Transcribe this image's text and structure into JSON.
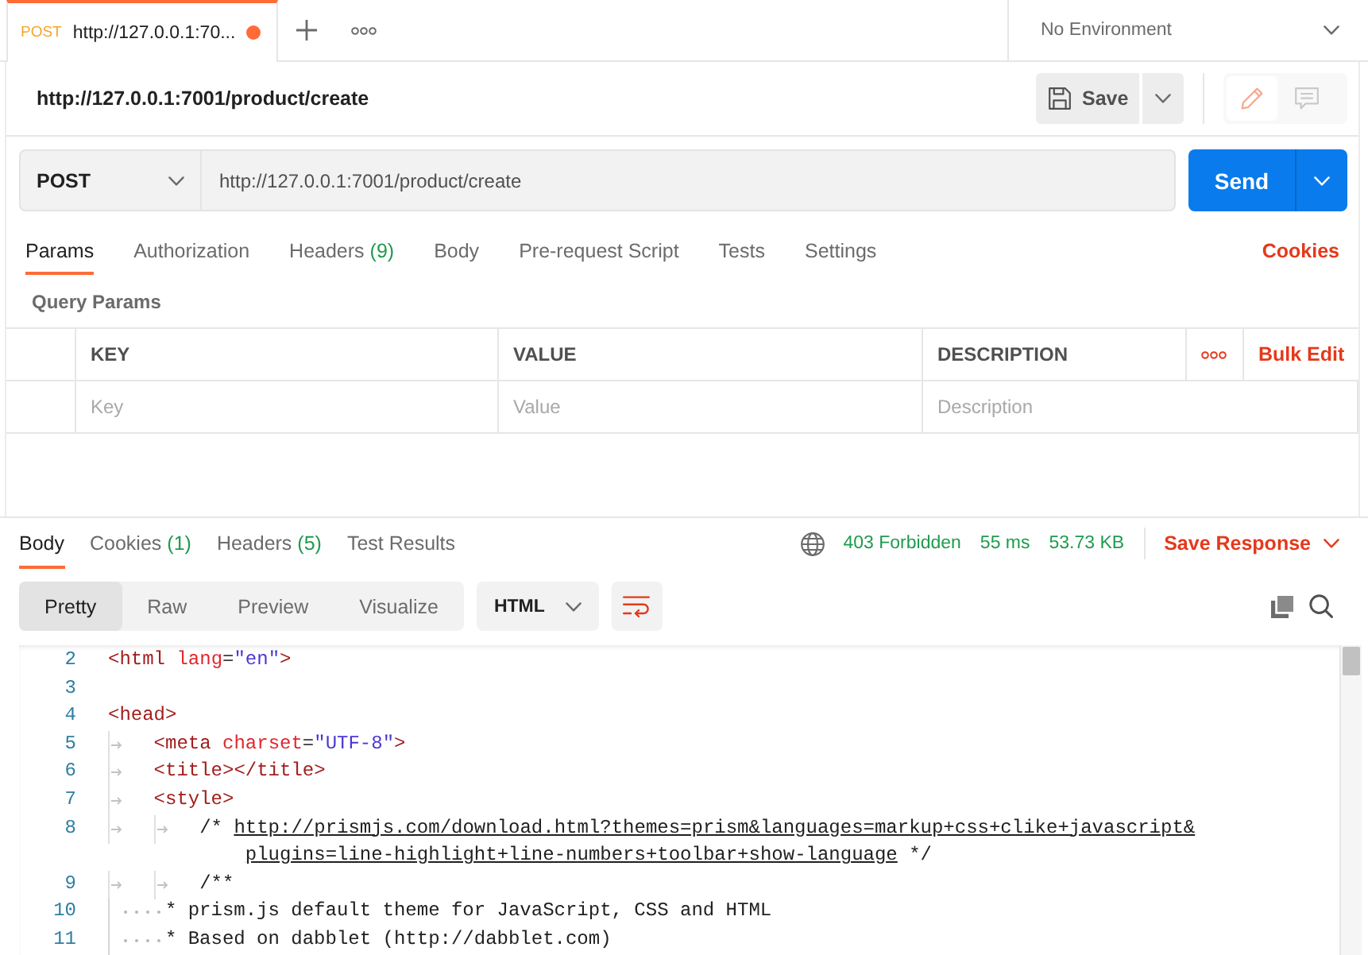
{
  "tab_bar": {
    "tabs": [
      {
        "method": "POST",
        "title": "http://127.0.0.1:70...",
        "selected": true,
        "unsaved": true
      }
    ]
  },
  "environment": {
    "value": "No Environment"
  },
  "request": {
    "name": "http://127.0.0.1:7001/product/create",
    "save": "Save",
    "method": "POST",
    "url": "http://127.0.0.1:7001/product/create",
    "send": "Send"
  },
  "request_tabs": [
    {
      "label": "Params",
      "selected": true
    },
    {
      "label": "Authorization",
      "selected": false
    },
    {
      "label": "Headers",
      "count": "(9)",
      "selected": false
    },
    {
      "label": "Body",
      "selected": false
    },
    {
      "label": "Pre-request Script",
      "selected": false
    },
    {
      "label": "Tests",
      "selected": false
    },
    {
      "label": "Settings",
      "selected": false
    }
  ],
  "cookies_link": "Cookies",
  "query_params": {
    "title": "Query Params",
    "columns": [
      "KEY",
      "VALUE",
      "DESCRIPTION"
    ],
    "bulk_edit": "Bulk Edit",
    "new_row": {
      "key": {
        "placeholder": "Key"
      },
      "value": {
        "placeholder": "Value"
      },
      "description": {
        "placeholder": "Description"
      }
    }
  },
  "response_tabs": [
    {
      "label": "Body",
      "selected": true
    },
    {
      "label": "Cookies",
      "count": "(1)",
      "selected": false
    },
    {
      "label": "Headers",
      "count": "(5)",
      "selected": false
    },
    {
      "label": "Test Results",
      "selected": false
    }
  ],
  "response_status": {
    "status": "403 Forbidden",
    "time": "55 ms",
    "size": "53.73 KB"
  },
  "save_response": "Save Response",
  "view_modes": [
    {
      "label": "Pretty",
      "selected": true
    },
    {
      "label": "Raw",
      "selected": false
    },
    {
      "label": "Preview",
      "selected": false
    },
    {
      "label": "Visualize",
      "selected": false
    }
  ],
  "language": "HTML",
  "wrap_lines": {
    "on": true
  },
  "code": {
    "lines": [
      {
        "number": "2",
        "tokens": [
          {
            "kind": "tag",
            "text": "<html"
          },
          {
            "kind": "attr",
            "text": " lang"
          },
          {
            "kind": "punct",
            "text": "="
          },
          {
            "kind": "value",
            "text": "\"en\""
          },
          {
            "kind": "tag",
            "text": ">"
          }
        ]
      },
      {
        "number": "3"
      },
      {
        "number": "4",
        "tokens": [
          {
            "kind": "tag",
            "text": "<head>"
          }
        ]
      },
      {
        "number": "5",
        "indent": [
          {
            "kind": "tab"
          }
        ],
        "tokens": [
          {
            "kind": "tag",
            "text": "<meta"
          },
          {
            "kind": "attr",
            "text": " charset"
          },
          {
            "kind": "punct",
            "text": "="
          },
          {
            "kind": "value",
            "text": "\"UTF-8\""
          },
          {
            "kind": "tag",
            "text": ">"
          }
        ]
      },
      {
        "number": "6",
        "indent": [
          {
            "kind": "tab"
          }
        ],
        "tokens": [
          {
            "kind": "tag",
            "text": "<title></title>"
          }
        ]
      },
      {
        "number": "7",
        "indent": [
          {
            "kind": "tab"
          }
        ],
        "tokens": [
          {
            "kind": "tag",
            "text": "<style>"
          }
        ]
      },
      {
        "number": "8",
        "indent": [
          {
            "kind": "tab"
          },
          {
            "kind": "tab"
          }
        ],
        "tokens": [
          {
            "kind": "comment",
            "text": "/* "
          },
          {
            "kind": "link",
            "text": "http://prismjs.com/download.html?themes=prism&languages=markup+css+clike+javascript&"
          }
        ],
        "wrapped_tokens": [
          {
            "kind": "link",
            "text": "plugins=line-highlight+line-numbers+toolbar+show-language"
          },
          {
            "kind": "comment",
            "text": " */"
          }
        ]
      },
      {
        "number": "9",
        "indent": [
          {
            "kind": "tab"
          },
          {
            "kind": "tab"
          }
        ],
        "tokens": [
          {
            "kind": "comment",
            "text": "/**"
          }
        ]
      },
      {
        "number": "10",
        "indent": [
          {
            "kind": "space"
          },
          {
            "kind": "space"
          },
          {
            "kind": "space"
          },
          {
            "kind": "space"
          },
          {
            "kind": "space"
          }
        ],
        "tokens": [
          {
            "kind": "comment",
            "text": "* prism.js default theme for JavaScript, CSS and HTML"
          }
        ]
      },
      {
        "number": "11",
        "indent": [
          {
            "kind": "space"
          },
          {
            "kind": "space"
          },
          {
            "kind": "space"
          },
          {
            "kind": "space"
          },
          {
            "kind": "space"
          }
        ],
        "tokens": [
          {
            "kind": "comment",
            "text": "* Based on dabblet (http://dabblet.com)"
          }
        ]
      }
    ]
  }
}
